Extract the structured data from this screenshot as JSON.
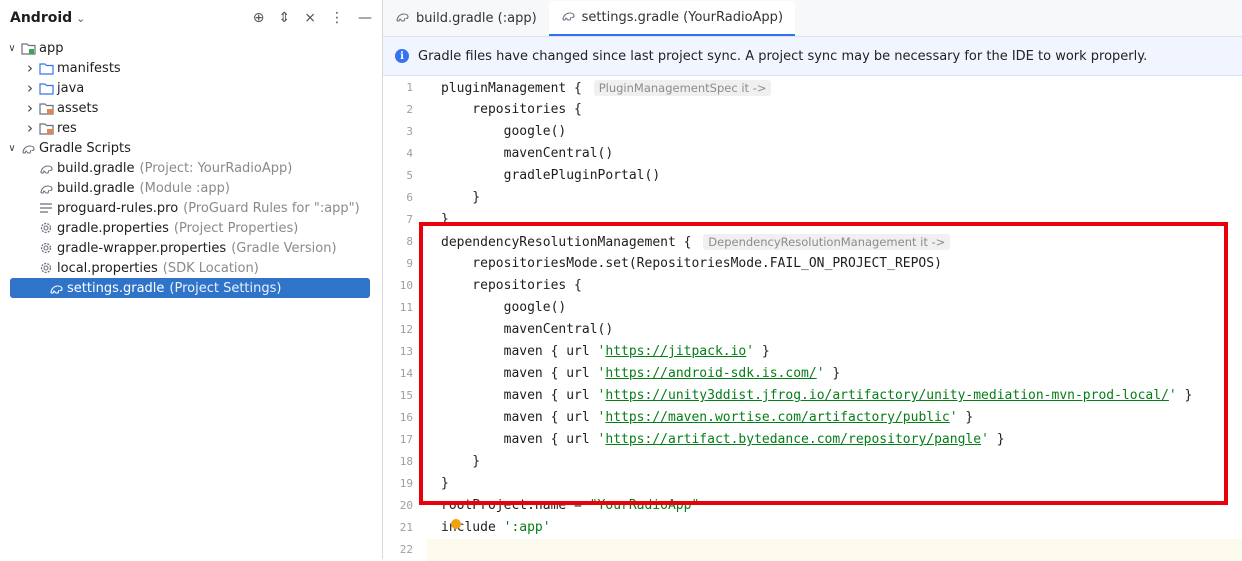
{
  "project_panel": {
    "title": "Android",
    "tree": [
      {
        "label": "app",
        "hint": "",
        "indent": 0,
        "arrow": "open",
        "icon": "app-module-icon"
      },
      {
        "label": "manifests",
        "hint": "",
        "indent": 1,
        "arrow": "closed",
        "icon": "folder-icon"
      },
      {
        "label": "java",
        "hint": "",
        "indent": 1,
        "arrow": "closed",
        "icon": "folder-icon"
      },
      {
        "label": "assets",
        "hint": "",
        "indent": 1,
        "arrow": "closed",
        "icon": "resource-folder-icon"
      },
      {
        "label": "res",
        "hint": "",
        "indent": 1,
        "arrow": "closed",
        "icon": "resource-folder-icon"
      },
      {
        "label": "Gradle Scripts",
        "hint": "",
        "indent": 0,
        "arrow": "open",
        "icon": "gradle-icon"
      },
      {
        "label": "build.gradle",
        "hint": "(Project: YourRadioApp)",
        "indent": 1,
        "arrow": "none",
        "icon": "gradle-icon"
      },
      {
        "label": "build.gradle",
        "hint": "(Module :app)",
        "indent": 1,
        "arrow": "none",
        "icon": "gradle-icon"
      },
      {
        "label": "proguard-rules.pro",
        "hint": "(ProGuard Rules for \":app\")",
        "indent": 1,
        "arrow": "none",
        "icon": "text-file-icon"
      },
      {
        "label": "gradle.properties",
        "hint": "(Project Properties)",
        "indent": 1,
        "arrow": "none",
        "icon": "settings-gear-icon"
      },
      {
        "label": "gradle-wrapper.properties",
        "hint": "(Gradle Version)",
        "indent": 1,
        "arrow": "none",
        "icon": "settings-gear-icon"
      },
      {
        "label": "local.properties",
        "hint": "(SDK Location)",
        "indent": 1,
        "arrow": "none",
        "icon": "settings-gear-icon"
      },
      {
        "label": "settings.gradle",
        "hint": "(Project Settings)",
        "indent": 1,
        "arrow": "none",
        "icon": "gradle-icon",
        "selected": true
      }
    ]
  },
  "tabs": [
    {
      "label": "build.gradle (:app)",
      "active": false
    },
    {
      "label": "settings.gradle (YourRadioApp)",
      "active": true
    }
  ],
  "banner": {
    "text": "Gradle files have changed since last project sync. A project sync may be necessary for the IDE to work properly."
  },
  "editor": {
    "lines": [
      {
        "n": "1",
        "parts": [
          {
            "t": "pluginManagement { "
          },
          {
            "c": "inlay",
            "t": "PluginManagementSpec it ->"
          }
        ]
      },
      {
        "n": "2",
        "parts": [
          {
            "t": "    repositories {"
          }
        ]
      },
      {
        "n": "3",
        "parts": [
          {
            "t": "        google()"
          }
        ]
      },
      {
        "n": "4",
        "parts": [
          {
            "t": "        mavenCentral()"
          }
        ]
      },
      {
        "n": "5",
        "parts": [
          {
            "t": "        gradlePluginPortal()"
          }
        ]
      },
      {
        "n": "6",
        "parts": [
          {
            "t": "    }"
          }
        ]
      },
      {
        "n": "7",
        "parts": [
          {
            "t": "}"
          }
        ]
      },
      {
        "n": "8",
        "parts": [
          {
            "t": "dependencyResolutionManagement { "
          },
          {
            "c": "inlay",
            "t": "DependencyResolutionManagement it ->"
          }
        ]
      },
      {
        "n": "9",
        "parts": [
          {
            "t": "    repositoriesMode.set(RepositoriesMode.FAIL_ON_PROJECT_REPOS)"
          }
        ]
      },
      {
        "n": "10",
        "parts": [
          {
            "t": "    repositories {"
          }
        ]
      },
      {
        "n": "11",
        "parts": [
          {
            "t": "        google()"
          }
        ]
      },
      {
        "n": "12",
        "parts": [
          {
            "t": "        mavenCentral()"
          }
        ]
      },
      {
        "n": "13",
        "parts": [
          {
            "t": "        maven { url "
          },
          {
            "c": "str",
            "t": "'"
          },
          {
            "c": "url",
            "t": "https://jitpack.io"
          },
          {
            "c": "str",
            "t": "'"
          },
          {
            "t": " }"
          }
        ]
      },
      {
        "n": "14",
        "parts": [
          {
            "t": "        maven { url "
          },
          {
            "c": "str",
            "t": "'"
          },
          {
            "c": "url",
            "t": "https://android-sdk.is.com/"
          },
          {
            "c": "str",
            "t": "'"
          },
          {
            "t": " }"
          }
        ]
      },
      {
        "n": "15",
        "parts": [
          {
            "t": "        maven { url "
          },
          {
            "c": "str",
            "t": "'"
          },
          {
            "c": "url",
            "t": "https://unity3ddist.jfrog.io/artifactory/unity-mediation-mvn-prod-local/"
          },
          {
            "c": "str",
            "t": "'"
          },
          {
            "t": " }"
          }
        ]
      },
      {
        "n": "16",
        "parts": [
          {
            "t": "        maven { url "
          },
          {
            "c": "str",
            "t": "'"
          },
          {
            "c": "url",
            "t": "https://maven.wortise.com/artifactory/public"
          },
          {
            "c": "str",
            "t": "'"
          },
          {
            "t": " }"
          }
        ]
      },
      {
        "n": "17",
        "parts": [
          {
            "t": "        maven { url "
          },
          {
            "c": "str",
            "t": "'"
          },
          {
            "c": "url",
            "t": "https://artifact.bytedance.com/repository/pangle"
          },
          {
            "c": "str",
            "t": "'"
          },
          {
            "t": " }"
          }
        ]
      },
      {
        "n": "18",
        "parts": [
          {
            "t": "    }"
          }
        ]
      },
      {
        "n": "19",
        "parts": [
          {
            "t": "}"
          }
        ]
      },
      {
        "n": "20",
        "parts": [
          {
            "t": "rootProject.name = "
          },
          {
            "c": "str",
            "t": "\"YourRadioApp\""
          }
        ]
      },
      {
        "n": "21",
        "parts": [
          {
            "t": "include "
          },
          {
            "c": "str",
            "t": "':app'"
          }
        ]
      },
      {
        "n": "22",
        "parts": [
          {
            "t": ""
          }
        ]
      }
    ]
  },
  "colors": {
    "selection": "#2f74c8",
    "highlight_box": "#e8000b",
    "string": "#067d17",
    "banner_bg": "#f0f5ff"
  }
}
